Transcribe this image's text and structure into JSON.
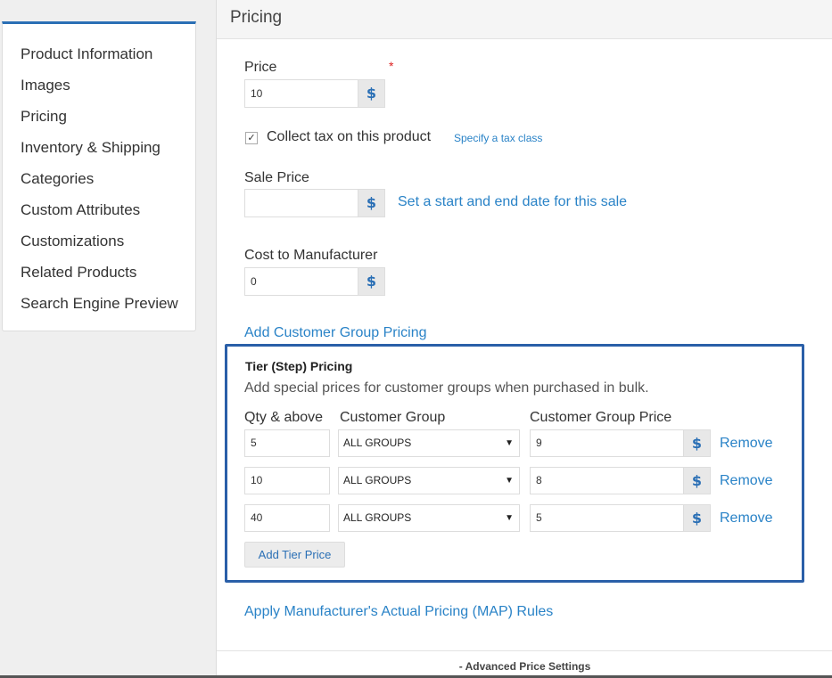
{
  "sidebar": {
    "items": [
      {
        "label": "Product Information"
      },
      {
        "label": "Images"
      },
      {
        "label": "Pricing"
      },
      {
        "label": "Inventory & Shipping"
      },
      {
        "label": "Categories"
      },
      {
        "label": "Custom Attributes"
      },
      {
        "label": "Customizations"
      },
      {
        "label": "Related Products"
      },
      {
        "label": "Search Engine Preview"
      }
    ]
  },
  "section": {
    "title": "Pricing"
  },
  "price": {
    "label": "Price",
    "required_mark": "*",
    "value": "10",
    "currency": "$"
  },
  "tax": {
    "checked": true,
    "check_glyph": "✓",
    "label": "Collect tax on this product",
    "link": "Specify a tax class"
  },
  "sale_price": {
    "label": "Sale Price",
    "value": "",
    "currency": "$",
    "date_link": "Set a start and end date for this sale"
  },
  "cost": {
    "label": "Cost to Manufacturer",
    "value": "0",
    "currency": "$"
  },
  "customer_group_link": "Add Customer Group Pricing",
  "tier": {
    "title": "Tier (Step) Pricing",
    "description": "Add special prices for customer groups when purchased in bulk.",
    "columns": {
      "qty": "Qty & above",
      "group": "Customer Group",
      "price": "Customer Group Price"
    },
    "rows": [
      {
        "qty": "5",
        "group": "ALL GROUPS",
        "price": "9",
        "currency": "$",
        "remove": "Remove"
      },
      {
        "qty": "10",
        "group": "ALL GROUPS",
        "price": "8",
        "currency": "$",
        "remove": "Remove"
      },
      {
        "qty": "40",
        "group": "ALL GROUPS",
        "price": "5",
        "currency": "$",
        "remove": "Remove"
      }
    ],
    "select_arrow": "▼",
    "add_button": "Add Tier Price",
    "accent_color": "#2a5fa8"
  },
  "map_link": "Apply Manufacturer's Actual Pricing (MAP) Rules",
  "footer": {
    "label": "- Advanced Price Settings"
  },
  "colors": {
    "link": "#2a83c7",
    "accent": "#2a6fb5",
    "required": "#dd2222"
  }
}
